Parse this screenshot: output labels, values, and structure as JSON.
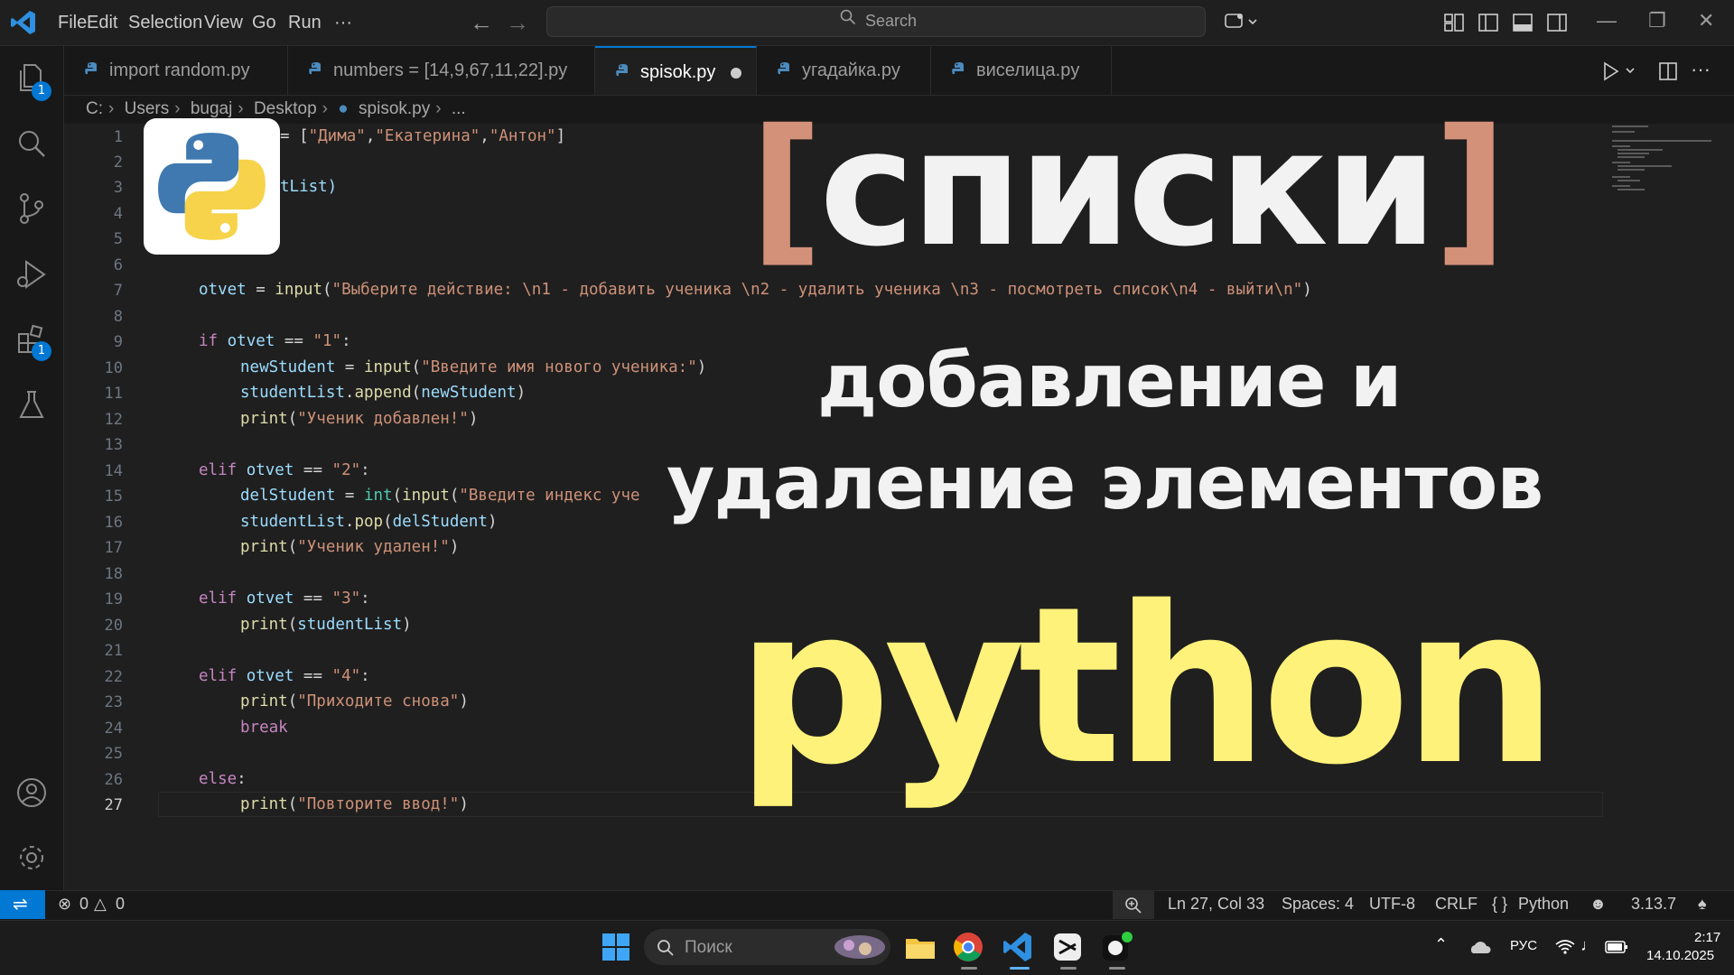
{
  "titlebar": {
    "menu": [
      "File",
      "Edit",
      "Selection",
      "View",
      "Go",
      "Run",
      "···"
    ],
    "search_label": "Search"
  },
  "activity": {
    "explorer_badge": "1",
    "extensions_badge": "1"
  },
  "tabs": [
    {
      "label": "import random.py"
    },
    {
      "label": "numbers = [14,9,67,11,22].py"
    },
    {
      "label": "spisok.py",
      "active": true,
      "dirty": true
    },
    {
      "label": "угадайка.py"
    },
    {
      "label": "виселица.py"
    }
  ],
  "breadcrumb": [
    "C:",
    "Users",
    "bugaj",
    "Desktop",
    "spisok.py",
    "..."
  ],
  "editor": {
    "line_numbers": [
      "1",
      "2",
      "3",
      "4",
      "5",
      "6",
      "7",
      "8",
      "9",
      "10",
      "11",
      "12",
      "13",
      "14",
      "15",
      "16",
      "17",
      "18",
      "19",
      "20",
      "21",
      "22",
      "23",
      "24",
      "25",
      "26",
      "27"
    ],
    "current_line": "27",
    "code": {
      "l1_a": "= [",
      "l1_s1": "\"Дима\"",
      "l1_s2": "\"Екатерина\"",
      "l1_s3": "\"Антон\"",
      "l1_c": "]",
      "l3": "tList)",
      "l7_var": "otvet",
      "l7_fn": "input",
      "l7_str": "\"Выберите действие: \\n1 - добавить ученика \\n2 - удалить ученика \\n3 - посмотреть список\\n4 - выйти\\n\"",
      "kw_if": "if",
      "kw_elif": "elif",
      "kw_else": "else",
      "kw_break": "break",
      "s1": "\"1\"",
      "s2": "\"2\"",
      "s3": "\"3\"",
      "s4": "\"4\"",
      "l10_var": "newStudent",
      "l10_str": "\"Введите имя нового ученика:\"",
      "list_var": "studentList",
      "append": "append",
      "pop": "pop",
      "print": "print",
      "l12_str": "\"Ученик добавлен!\"",
      "l15_var": "delStudent",
      "l15_int": "int",
      "l15_str": "\"Введите индекс уче",
      "l17_str": "\"Ученик удален!\"",
      "l23_str": "\"Приходите снова\"",
      "l27_str": "\"Повторите ввод!\""
    }
  },
  "overlay": {
    "bracket_open": "[",
    "title": "списки",
    "bracket_close": "]",
    "subtitle_1": "добавление и",
    "subtitle_2": "удаление элементов",
    "word": "python",
    "bracket_color": "#d4917a",
    "word_color": "#fff27a"
  },
  "statusbar": {
    "errors": "0",
    "warnings": "0",
    "position": "Ln 27, Col 33",
    "spaces": "Spaces: 4",
    "encoding": "UTF-8",
    "eol": "CRLF",
    "language_braces": "{ }",
    "language": "Python",
    "version": "3.13.7"
  },
  "taskbar": {
    "search_placeholder": "Поиск",
    "lang": "РУС",
    "time": "2:17",
    "date": "14.10.2025"
  },
  "colors": {
    "accent": "#0078d4",
    "editor_bg": "#1f1f1f"
  }
}
